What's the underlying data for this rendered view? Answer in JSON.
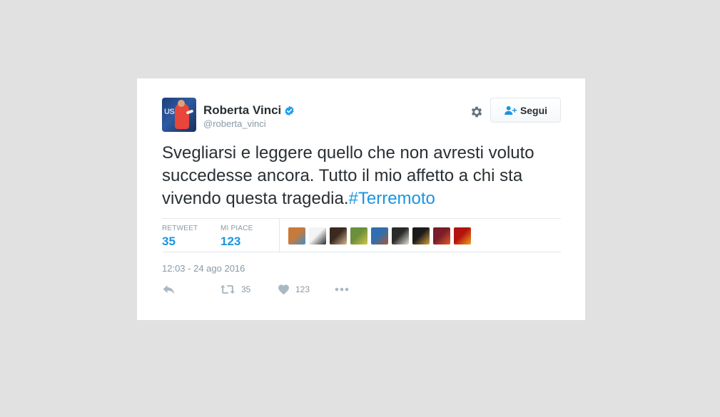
{
  "tweet": {
    "author": {
      "name": "Roberta Vinci",
      "handle": "@roberta_vinci",
      "avatar_logo_text": "US"
    },
    "follow_button_label": "Segui",
    "text_main": "Svegliarsi e leggere quello che non avresti voluto succedesse ancora. Tutto il mio affetto a chi sta vivendo questa tragedia.",
    "hashtag": "#Terremoto",
    "stats": {
      "retweet_label": "RETWEET",
      "retweet_count": "35",
      "likes_label": "MI PIACE",
      "likes_count": "123"
    },
    "liker_avatars": [
      {
        "icon": "liker-avatar",
        "colors": [
          "#c87a3a",
          "#3f8fc9"
        ]
      },
      {
        "icon": "liker-avatar",
        "colors": [
          "#f4f4f4",
          "#2a2a2a"
        ]
      },
      {
        "icon": "liker-avatar",
        "colors": [
          "#3a2a20",
          "#d9b890"
        ]
      },
      {
        "icon": "liker-avatar",
        "colors": [
          "#6b8f3a",
          "#d2c54a"
        ]
      },
      {
        "icon": "liker-avatar",
        "colors": [
          "#2f6fb0",
          "#a35a3c"
        ]
      },
      {
        "icon": "liker-avatar",
        "colors": [
          "#2a2a2a",
          "#e9e2d7"
        ]
      },
      {
        "icon": "liker-avatar",
        "colors": [
          "#1b1b1b",
          "#d7a33a"
        ]
      },
      {
        "icon": "liker-avatar",
        "colors": [
          "#7a1c2a",
          "#e05a2a"
        ]
      },
      {
        "icon": "liker-avatar",
        "colors": [
          "#b3120f",
          "#f1a11c"
        ]
      }
    ],
    "timestamp": "12:03 - 24 ago 2016",
    "actions": {
      "reply_icon": "reply-icon",
      "retweet_icon": "retweet-icon",
      "retweet_count": "35",
      "like_icon": "heart-icon",
      "like_count": "123",
      "more_icon": "more-icon"
    }
  },
  "colors": {
    "background": "#e1e1e1",
    "card": "#ffffff",
    "link": "#1b95e0",
    "muted": "#8899a6",
    "text": "#292f33",
    "verified": "#1da1f2"
  }
}
